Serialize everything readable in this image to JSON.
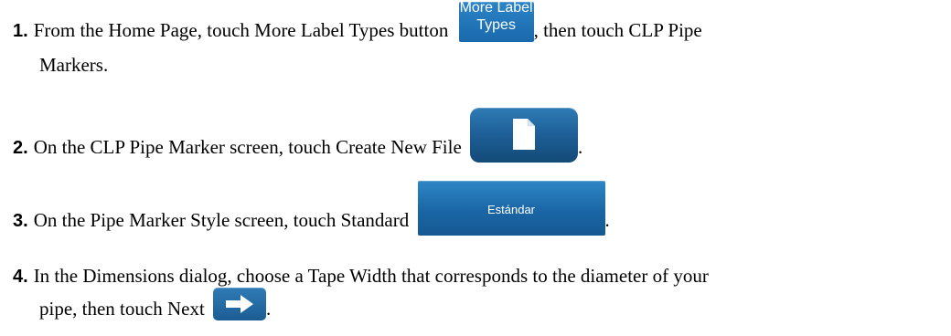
{
  "steps": [
    {
      "num": "1.",
      "text_before": "From the Home Page, touch More Label Types button",
      "text_after": ", then touch CLP Pipe",
      "line2": "Markers.",
      "button_label_1": "More Label",
      "button_label_2": "Types"
    },
    {
      "num": "2.",
      "text_before": "On the CLP Pipe Marker screen, touch Create New File",
      "text_after": ".",
      "button_icon": "new-file-icon"
    },
    {
      "num": "3.",
      "text_before": "On the Pipe Marker Style screen, touch Standard",
      "text_after": ".",
      "button_label": "Estándar"
    },
    {
      "num": "4.",
      "text_before": "In the Dimensions dialog, choose a Tape Width that corresponds to the diameter of your",
      "line2_before": "pipe, then touch Next",
      "text_after": ".",
      "button_icon": "arrow-right-icon"
    }
  ],
  "colors": {
    "button_blue": "#1a66a6",
    "text": "#000000"
  }
}
